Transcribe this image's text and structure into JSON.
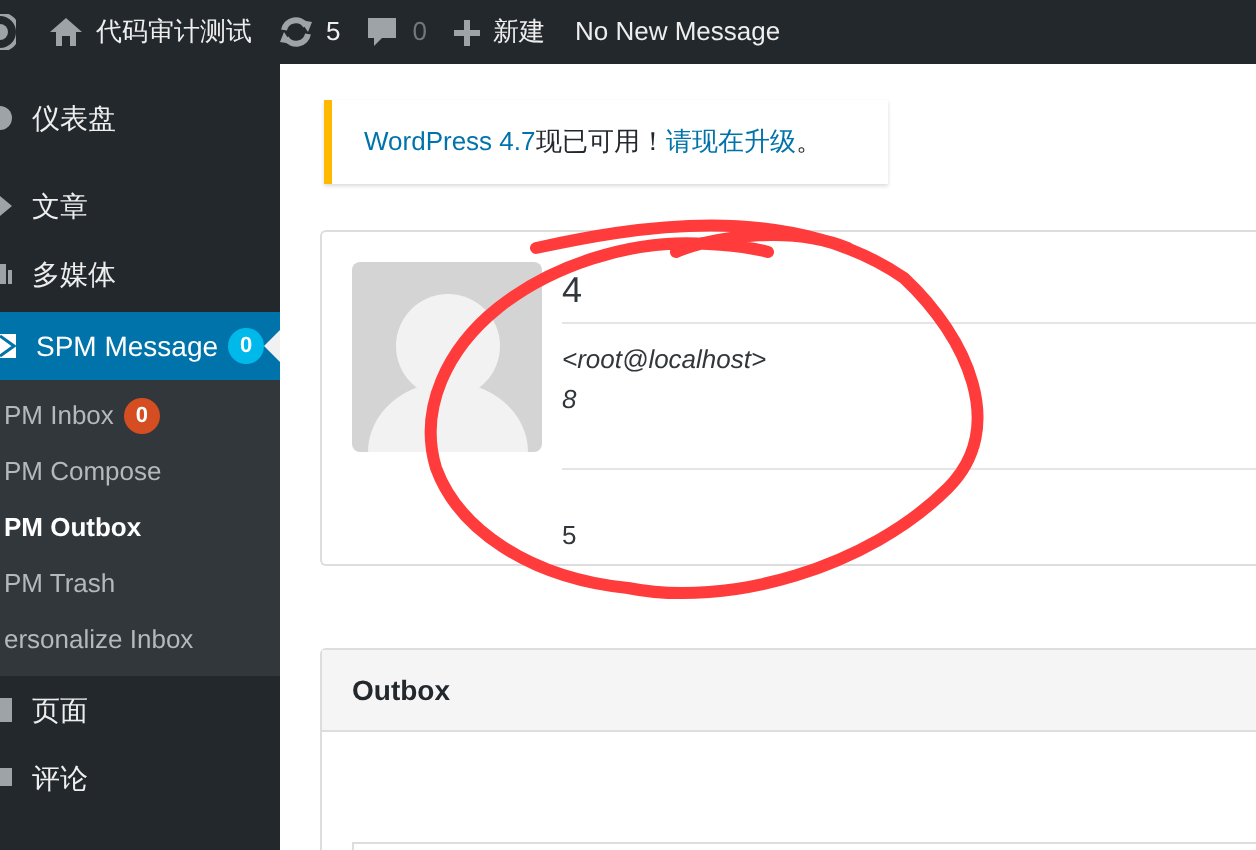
{
  "admin_bar": {
    "site_name": "代码审计测试",
    "updates": "5",
    "comments": "0",
    "new": "新建",
    "message_status": "No New Message"
  },
  "sidebar": {
    "items": [
      {
        "label": "仪表盘",
        "kind": "dashboard",
        "selected": false
      },
      {
        "label": "文章",
        "kind": "pin",
        "selected": false
      },
      {
        "label": "多媒体",
        "kind": "media",
        "selected": false
      },
      {
        "label": "SPM Message",
        "kind": "mail",
        "selected": true,
        "count": "0",
        "children": [
          {
            "label": "PM Inbox",
            "count": "0",
            "selected": false
          },
          {
            "label": "PM Compose",
            "selected": false
          },
          {
            "label": "PM Outbox",
            "selected": true
          },
          {
            "label": "PM Trash",
            "selected": false
          },
          {
            "label": "ersonalize Inbox",
            "selected": false
          }
        ]
      },
      {
        "label": "页面",
        "kind": "page",
        "selected": false
      },
      {
        "label": "评论",
        "kind": "comment",
        "selected": false
      }
    ]
  },
  "notice": {
    "version_link": "WordPress 4.7",
    "text": "现已可用！",
    "upgrade_link": "请现在升级",
    "end": "。"
  },
  "message": {
    "subject": "4",
    "sender": "<root@localhost>",
    "date": "8",
    "body": "5"
  },
  "outbox": {
    "title": "Outbox"
  }
}
